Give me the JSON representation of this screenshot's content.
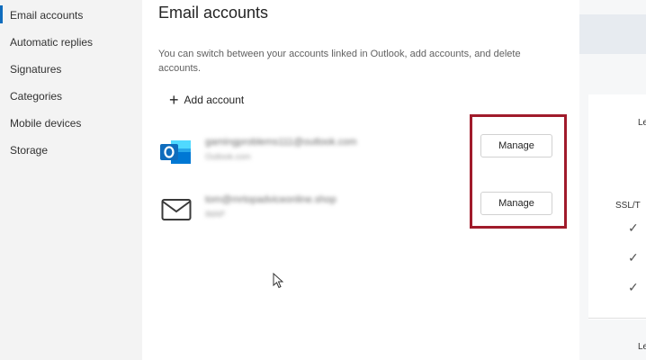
{
  "nav": {
    "items": [
      {
        "label": "Email accounts"
      },
      {
        "label": "Automatic replies"
      },
      {
        "label": "Signatures"
      },
      {
        "label": "Categories"
      },
      {
        "label": "Mobile devices"
      },
      {
        "label": "Storage"
      }
    ]
  },
  "panel": {
    "title": "Email accounts",
    "description": "You can switch between your accounts linked in Outlook, add accounts, and delete accounts.",
    "add_account_label": "Add account",
    "accounts": [
      {
        "email": "gamingproblems111@outlook.com",
        "type": "Outlook.com",
        "manage_label": "Manage",
        "icon": "outlook-icon"
      },
      {
        "email": "tom@mrtopadviceonline.shop",
        "type": "IMAP",
        "manage_label": "Manage",
        "icon": "mail-envelope-icon"
      }
    ]
  },
  "right_panel": {
    "label_1": "Le",
    "label_2": "SSL/T",
    "label_3": "Le"
  },
  "colors": {
    "highlight": "#a01b2b",
    "outlook_blue": "#0f6cbd",
    "active_nav": "#0f6cbd"
  }
}
